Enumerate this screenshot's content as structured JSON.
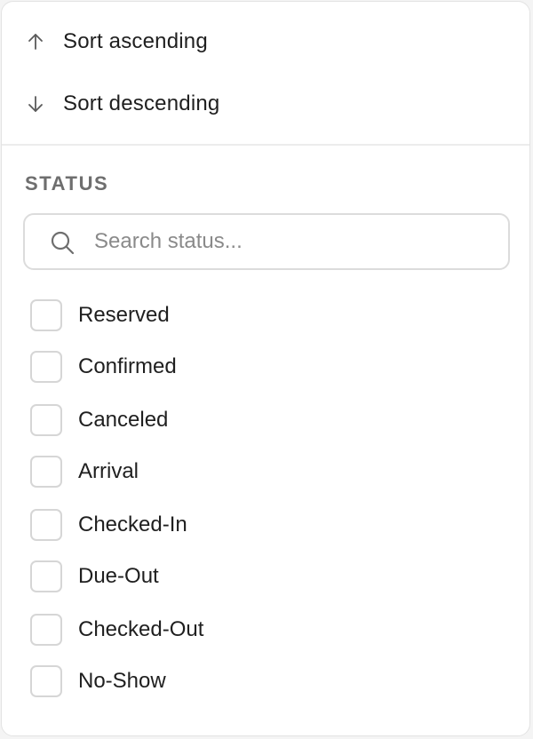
{
  "sort": {
    "ascending_label": "Sort ascending",
    "descending_label": "Sort descending"
  },
  "filter": {
    "section_title": "STATUS",
    "search_placeholder": "Search status...",
    "search_value": "",
    "options": [
      {
        "label": "Reserved",
        "checked": false
      },
      {
        "label": "Confirmed",
        "checked": false
      },
      {
        "label": "Canceled",
        "checked": false
      },
      {
        "label": "Arrival",
        "checked": false
      },
      {
        "label": "Checked-In",
        "checked": false
      },
      {
        "label": "Due-Out",
        "checked": false
      },
      {
        "label": "Checked-Out",
        "checked": false
      },
      {
        "label": "No-Show",
        "checked": false
      }
    ]
  },
  "icons": {
    "ascending": "arrow-up-icon",
    "descending": "arrow-down-icon",
    "search": "search-icon"
  },
  "colors": {
    "text": "#1f1f1f",
    "muted": "#6e6e6e",
    "border": "#dcdcdc"
  }
}
